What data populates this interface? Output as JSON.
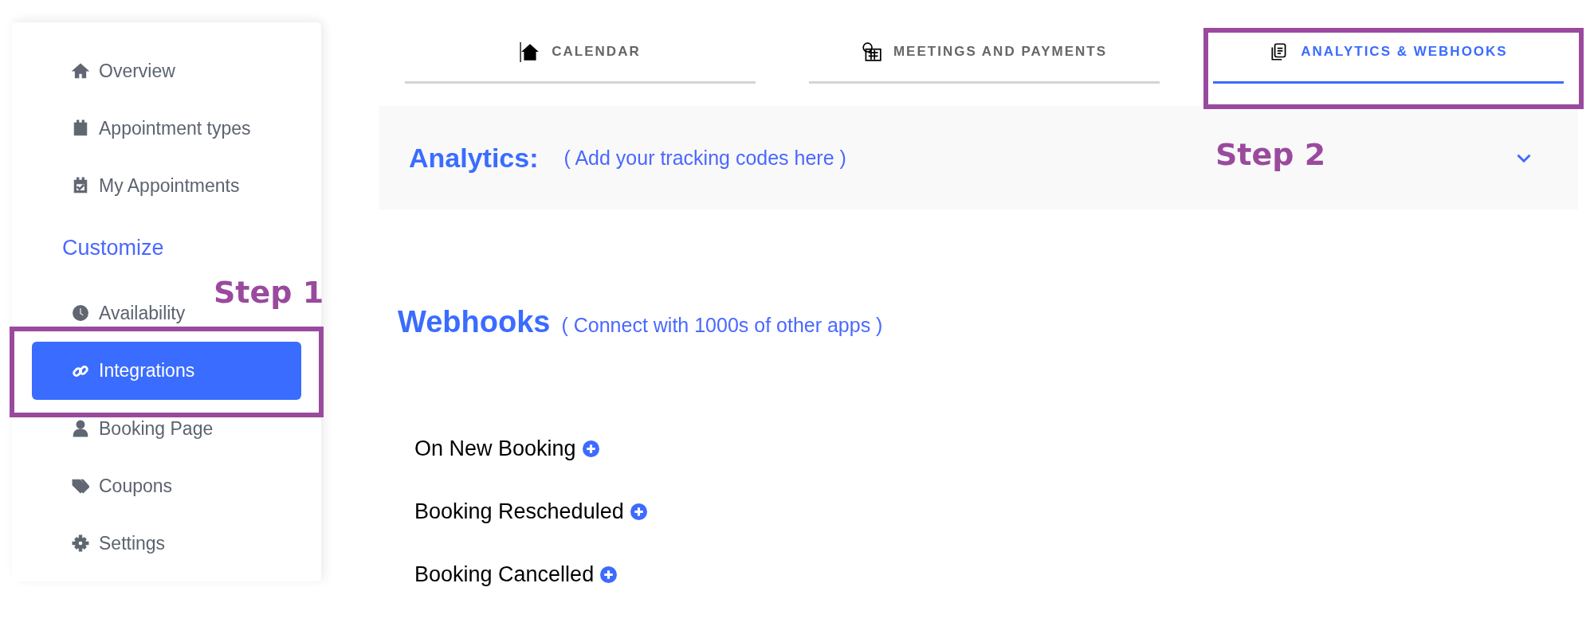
{
  "sidebar": {
    "items": [
      {
        "label": "Overview",
        "selected": false
      },
      {
        "label": "Appointment types",
        "selected": false
      },
      {
        "label": "My Appointments",
        "selected": false
      }
    ],
    "section_heading": "Customize",
    "section_items": [
      {
        "label": "Availability",
        "selected": false
      },
      {
        "label": "Integrations",
        "selected": true
      },
      {
        "label": "Booking Page",
        "selected": false
      },
      {
        "label": "Coupons",
        "selected": false
      },
      {
        "label": "Settings",
        "selected": false
      }
    ]
  },
  "tabs": [
    {
      "label": "CALENDAR",
      "selected": false
    },
    {
      "label": "MEETINGS AND PAYMENTS",
      "selected": false
    },
    {
      "label": "ANALYTICS & WEBHOOKS",
      "selected": true
    }
  ],
  "analytics": {
    "title": "Analytics:",
    "hint": "( Add your tracking codes here )",
    "expanded": false
  },
  "webhooks": {
    "title": "Webhooks",
    "hint": "( Connect with 1000s of other apps )",
    "events": [
      {
        "label": "On New Booking"
      },
      {
        "label": "Booking Rescheduled"
      },
      {
        "label": "Booking Cancelled"
      }
    ]
  },
  "annotations": [
    {
      "label": "Step 1"
    },
    {
      "label": "Step 2"
    }
  ]
}
